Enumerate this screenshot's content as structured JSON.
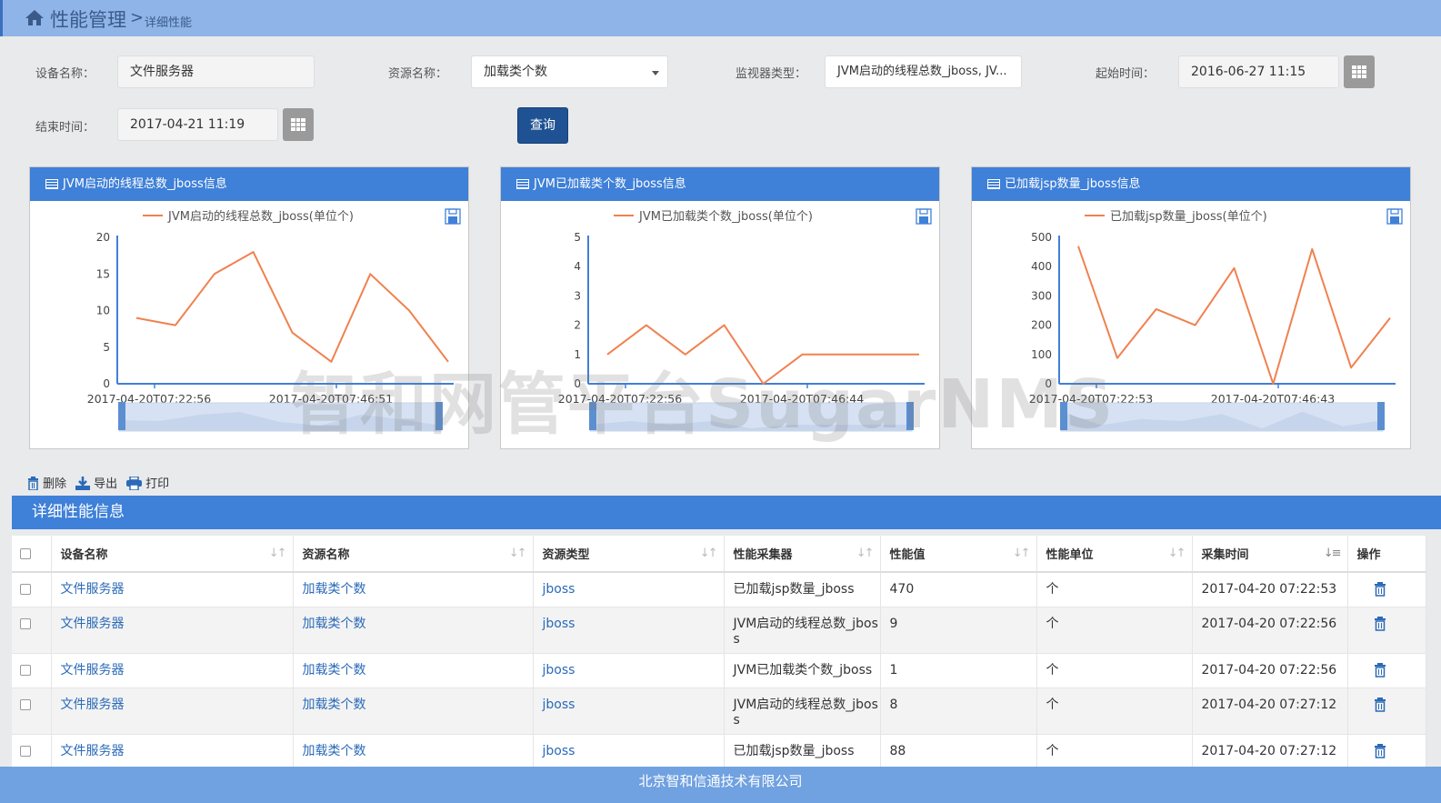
{
  "breadcrumb": {
    "main": "性能管理",
    "separator": ">",
    "current": "详细性能"
  },
  "filters": {
    "device_label": "设备名称：",
    "device_value": "文件服务器",
    "resource_label": "资源名称：",
    "resource_value": "加载类个数",
    "monitor_label": "监视器类型：",
    "monitor_value": "JVM启动的线程总数_jboss, JV...",
    "start_label": "起始时间：",
    "start_value": "2016-06-27 11:15",
    "end_label": "结束时间：",
    "end_value": "2017-04-21 11:19",
    "query_label": "查询"
  },
  "chart_data": [
    {
      "type": "line",
      "title": "JVM启动的线程总数_jboss信息",
      "legend": "JVM启动的线程总数_jboss(单位个)",
      "series": [
        {
          "name": "JVM启动的线程总数_jboss(单位个)",
          "values": [
            9,
            8,
            15,
            18,
            7,
            3,
            15,
            10,
            3
          ]
        }
      ],
      "x_tick_labels": [
        "2017-04-20T07:22:56",
        "2017-04-20T07:46:51"
      ],
      "y_ticks": [
        0,
        5,
        10,
        15,
        20
      ],
      "ylim": [
        0,
        20
      ],
      "color": "#f0814f"
    },
    {
      "type": "line",
      "title": "JVM已加载类个数_jboss信息",
      "legend": "JVM已加载类个数_jboss(单位个)",
      "series": [
        {
          "name": "JVM已加载类个数_jboss(单位个)",
          "values": [
            1,
            2,
            1,
            2,
            0,
            1,
            1,
            1,
            1
          ]
        }
      ],
      "x_tick_labels": [
        "2017-04-20T07:22:56",
        "2017-04-20T07:46:44"
      ],
      "y_ticks": [
        0,
        1,
        2,
        3,
        4,
        5
      ],
      "ylim": [
        0,
        5
      ],
      "color": "#f0814f"
    },
    {
      "type": "line",
      "title": "已加载jsp数量_jboss信息",
      "legend": "已加载jsp数量_jboss(单位个)",
      "series": [
        {
          "name": "已加载jsp数量_jboss(单位个)",
          "values": [
            470,
            88,
            255,
            200,
            395,
            0,
            460,
            55,
            225
          ]
        }
      ],
      "x_tick_labels": [
        "2017-04-20T07:22:53",
        "2017-04-20T07:46:43"
      ],
      "y_ticks": [
        0,
        100,
        200,
        300,
        400,
        500
      ],
      "ylim": [
        0,
        500
      ],
      "color": "#f0814f"
    }
  ],
  "toolbar": {
    "delete": "删除",
    "export": "导出",
    "print": "打印"
  },
  "detail_title": "详细性能信息",
  "table": {
    "headers": [
      "设备名称",
      "资源名称",
      "资源类型",
      "性能采集器",
      "性能值",
      "性能单位",
      "采集时间",
      "操作"
    ],
    "rows": [
      [
        "文件服务器",
        "加载类个数",
        "jboss",
        "已加载jsp数量_jboss",
        "470",
        "个",
        "2017-04-20 07:22:53"
      ],
      [
        "文件服务器",
        "加载类个数",
        "jboss",
        "JVM启动的线程总数_jboss",
        "9",
        "个",
        "2017-04-20 07:22:56"
      ],
      [
        "文件服务器",
        "加载类个数",
        "jboss",
        "JVM已加载类个数_jboss",
        "1",
        "个",
        "2017-04-20 07:22:56"
      ],
      [
        "文件服务器",
        "加载类个数",
        "jboss",
        "JVM启动的线程总数_jboss",
        "8",
        "个",
        "2017-04-20 07:27:12"
      ],
      [
        "文件服务器",
        "加载类个数",
        "jboss",
        "已加载jsp数量_jboss",
        "88",
        "个",
        "2017-04-20 07:27:12"
      ]
    ]
  },
  "footer": "北京智和信通技术有限公司",
  "watermark": "智和网管平台SugarNMS"
}
